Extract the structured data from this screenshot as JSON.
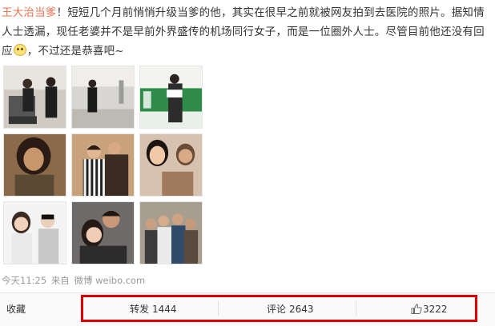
{
  "post": {
    "author": "王大治当爹",
    "text_part1": "！短短几个月前悄悄升级当爹的他，其实在很早之前就被网友拍到去医院的照片。据知情人士透漏，现任老婆并不是早前外界盛传的机场同行女子，而是一位圈外人士。尽管目前他还没有回应",
    "emoji": "cat-face-emoji",
    "text_part2": "，不过还是恭喜吧~"
  },
  "meta": {
    "time": "今天11:25",
    "from": "来自",
    "source": "微博 weibo.com"
  },
  "actions": {
    "favorite": "收藏",
    "repost_label": "转发",
    "repost_count": "1444",
    "comment_label": "评论",
    "comment_count": "2643",
    "like_icon": "thumbs-up-icon",
    "like_count": "3222"
  },
  "photos": [
    {
      "name": "photo-airport-couple"
    },
    {
      "name": "photo-airport-walk"
    },
    {
      "name": "photo-hospital-sign"
    },
    {
      "name": "photo-long-hair-man"
    },
    {
      "name": "photo-couple-portrait"
    },
    {
      "name": "photo-woman-collage"
    },
    {
      "name": "photo-two-women"
    },
    {
      "name": "photo-man-woman-selfie"
    },
    {
      "name": "photo-group-photo"
    }
  ],
  "colors": {
    "author": "#eb7350",
    "text": "#333333",
    "meta": "#999999",
    "highlight_border": "#e00000",
    "hospital_sign_green": "#2e8b4a"
  }
}
